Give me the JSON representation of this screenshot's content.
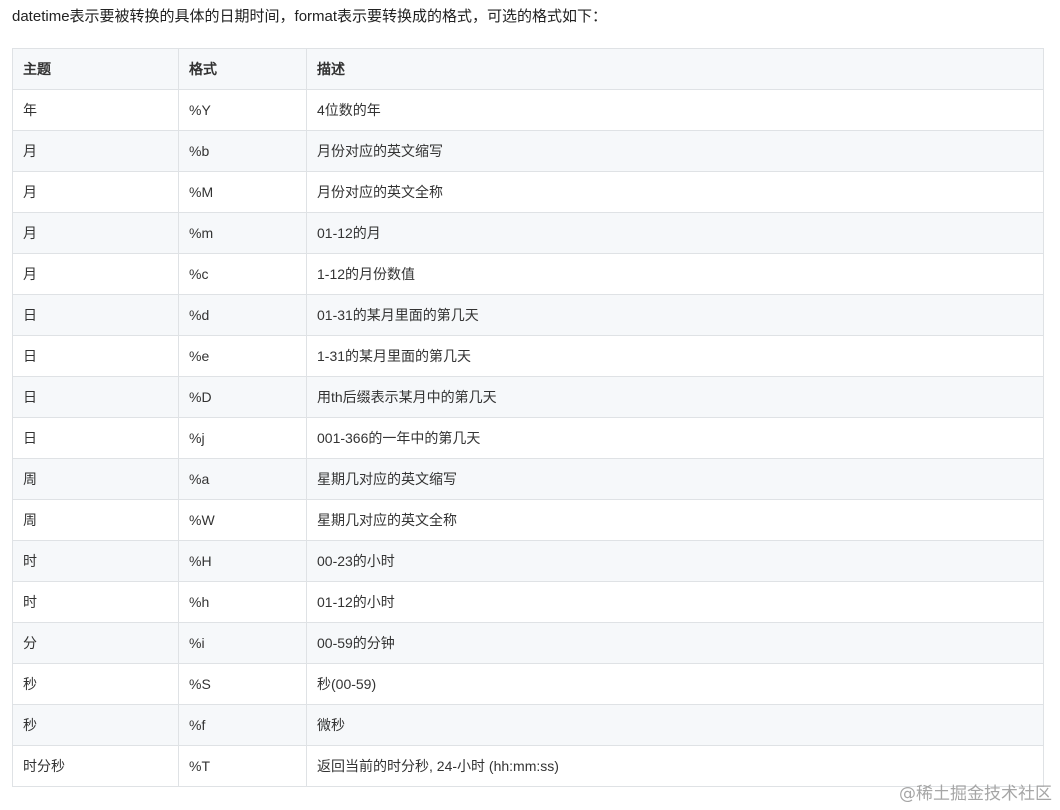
{
  "intro": "datetime表示要被转换的具体的日期时间，format表示要转换成的格式，可选的格式如下：",
  "table": {
    "headers": [
      "主题",
      "格式",
      "描述"
    ],
    "rows": [
      [
        "年",
        "%Y",
        "4位数的年"
      ],
      [
        "月",
        "%b",
        "月份对应的英文缩写"
      ],
      [
        "月",
        "%M",
        "月份对应的英文全称"
      ],
      [
        "月",
        "%m",
        "01-12的月"
      ],
      [
        "月",
        "%c",
        "1-12的月份数值"
      ],
      [
        "日",
        "%d",
        "01-31的某月里面的第几天"
      ],
      [
        "日",
        "%e",
        "1-31的某月里面的第几天"
      ],
      [
        "日",
        "%D",
        "用th后缀表示某月中的第几天"
      ],
      [
        "日",
        "%j",
        "001-366的一年中的第几天"
      ],
      [
        "周",
        "%a",
        "星期几对应的英文缩写"
      ],
      [
        "周",
        "%W",
        "星期几对应的英文全称"
      ],
      [
        "时",
        "%H",
        "00-23的小时"
      ],
      [
        "时",
        "%h",
        "01-12的小时"
      ],
      [
        "分",
        "%i",
        "00-59的分钟"
      ],
      [
        "秒",
        "%S",
        "秒(00-59)"
      ],
      [
        "秒",
        "%f",
        "微秒"
      ],
      [
        "时分秒",
        "%T",
        "返回当前的时分秒, 24-小时 (hh:mm:ss)"
      ]
    ]
  },
  "watermark": "@稀土掘金技术社区"
}
